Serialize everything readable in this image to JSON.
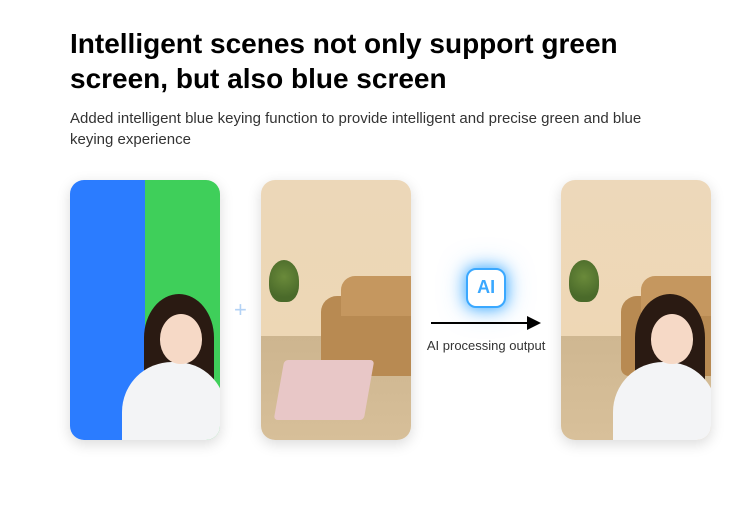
{
  "heading": "Intelligent scenes not only support green screen, but also blue screen",
  "subheading": "Added intelligent blue keying function to provide intelligent and precise green and blue keying experience",
  "plus_symbol": "+",
  "ai_badge": "AI",
  "ai_caption": "AI processing output"
}
